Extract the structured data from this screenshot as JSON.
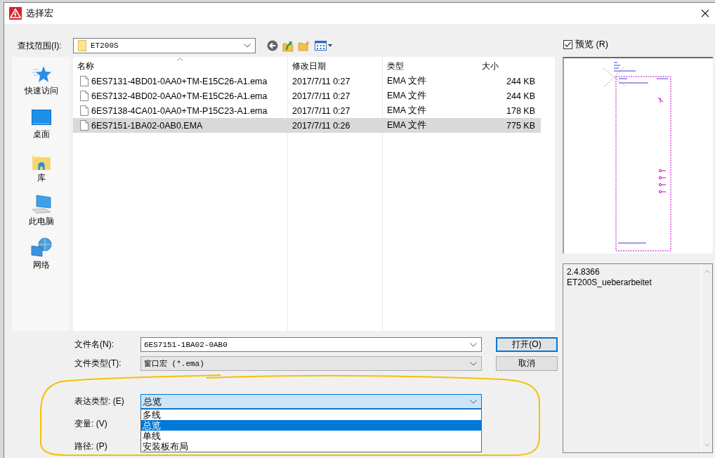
{
  "window": {
    "title": "选择宏"
  },
  "look_in": {
    "label": "查找范围(I):",
    "value": "ET200S"
  },
  "places": [
    {
      "kind": "quick_access",
      "label": "快速访问"
    },
    {
      "kind": "desktop",
      "label": "桌面"
    },
    {
      "kind": "library",
      "label": "库"
    },
    {
      "kind": "computer",
      "label": "此电脑"
    },
    {
      "kind": "network",
      "label": "网络"
    }
  ],
  "file_list": {
    "columns": [
      {
        "label": "名称",
        "sorted": true
      },
      {
        "label": "修改日期",
        "sorted": false
      },
      {
        "label": "类型",
        "sorted": false
      },
      {
        "label": "大小",
        "sorted": false
      }
    ],
    "rows": [
      {
        "name": "6ES7131-4BD01-0AA0+TM-E15C26-A1.ema",
        "modified": "2017/7/11 0:27",
        "type": "EMA 文件",
        "size": "244 KB",
        "selected": false
      },
      {
        "name": "6ES7132-4BD02-0AA0+TM-E15C26-A1.ema",
        "modified": "2017/7/11 0:27",
        "type": "EMA 文件",
        "size": "244 KB",
        "selected": false
      },
      {
        "name": "6ES7138-4CA01-0AA0+TM-P15C23-A1.ema",
        "modified": "2017/7/11 0:27",
        "type": "EMA 文件",
        "size": "178 KB",
        "selected": false
      },
      {
        "name": "6ES7151-1BA02-0AB0.EMA",
        "modified": "2017/7/11 0:26",
        "type": "EMA 文件",
        "size": "775 KB",
        "selected": true
      }
    ]
  },
  "file_name": {
    "label": "文件名(N):",
    "value": "6ES7151-1BA02-0AB0"
  },
  "file_type": {
    "label": "文件类型(T):",
    "value": "窗口宏 (*.ema)"
  },
  "buttons": [
    {
      "label": "打开(O)",
      "default": true
    },
    {
      "label": "取消",
      "default": false
    }
  ],
  "representation": {
    "label": "表达类型: (E)",
    "value": "总览",
    "expanded": true,
    "options": [
      {
        "label": "多线",
        "selected": false
      },
      {
        "label": "总览",
        "selected": true
      },
      {
        "label": "单线",
        "selected": false
      },
      {
        "label": "安装板布局",
        "selected": false
      }
    ]
  },
  "variant": {
    "label": "变量: (V)"
  },
  "path": {
    "label": "路径: (P)"
  },
  "preview": {
    "label": "预览 (R)",
    "checked": true
  },
  "info": {
    "lines": [
      "2.4.8366",
      "ET200S_ueberarbeitet"
    ]
  }
}
